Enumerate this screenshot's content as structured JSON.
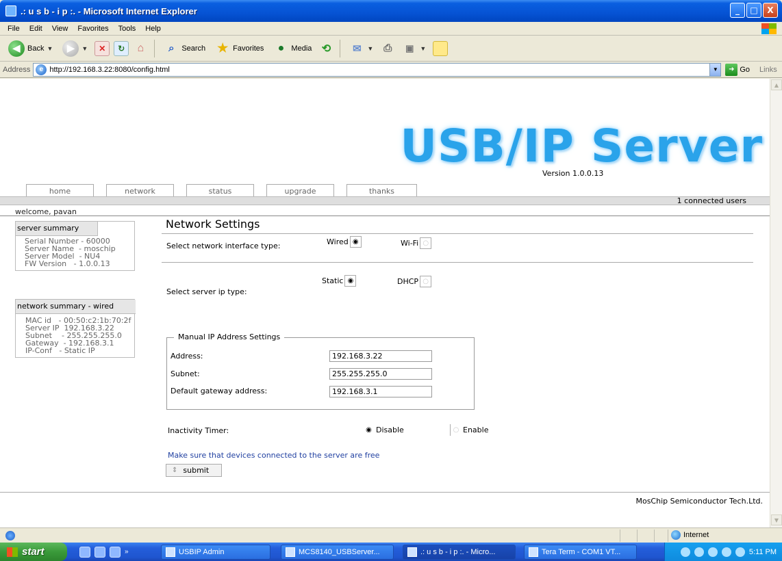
{
  "window": {
    "title": ".: u s b - i p :. - Microsoft Internet Explorer",
    "buttons": {
      "minimize": "_",
      "maximize": "□",
      "close": "X"
    }
  },
  "menu": [
    "File",
    "Edit",
    "View",
    "Favorites",
    "Tools",
    "Help"
  ],
  "toolbar": {
    "back": "Back",
    "search": "Search",
    "favorites": "Favorites",
    "media": "Media"
  },
  "address": {
    "label": "Address",
    "url": "http://192.168.3.22:8080/config.html",
    "go": "Go",
    "links": "Links"
  },
  "page": {
    "logo": "USB/IP Server",
    "version": "Version 1.0.0.13",
    "nav": [
      "home",
      "network",
      "status",
      "upgrade",
      "thanks"
    ],
    "connected": "1 connected users",
    "welcome": "welcome, pavan",
    "server_summary": {
      "title": "server summary",
      "lines": [
        "Serial Number - 60000",
        "Server Name  - moschip",
        "Server Model  - NU4",
        "FW Version   - 1.0.0.13"
      ]
    },
    "network_summary": {
      "title": "network summary - wired",
      "lines": [
        "MAC id   - 00:50:c2:1b:70:2f",
        "Server IP  192.168.3.22",
        "Subnet    - 255.255.255.0",
        "Gateway  - 192.168.3.1",
        "IP-Conf   - Static IP"
      ]
    },
    "section_title": "Network Settings",
    "interface": {
      "label": "Select network interface type:",
      "wired": "Wired",
      "wifi": "Wi-Fi",
      "selected": "Wired"
    },
    "ip_type": {
      "label": "Select server ip type:",
      "static": "Static",
      "dhcp": "DHCP",
      "selected": "Static"
    },
    "manual": {
      "legend": "Manual IP Address Settings",
      "address_label": "Address:",
      "address_value": "192.168.3.22",
      "subnet_label": "Subnet:",
      "subnet_value": "255.255.255.0",
      "gateway_label": "Default gateway address:",
      "gateway_value": "192.168.3.1"
    },
    "timer": {
      "label": "Inactivity Timer:",
      "disable": "Disable",
      "enable": "Enable",
      "selected": "Disable"
    },
    "note": "Make sure that devices connected to the server are free",
    "submit": "submit",
    "footer": "MosChip Semiconductor Tech.Ltd."
  },
  "status": {
    "zone": "Internet"
  },
  "taskbar": {
    "start": "start",
    "tasks": [
      "USBIP Admin",
      "MCS8140_USBServer...",
      ".: u s b - i p :. - Micro...",
      "Tera Term - COM1 VT..."
    ],
    "clock": "5:11 PM"
  }
}
